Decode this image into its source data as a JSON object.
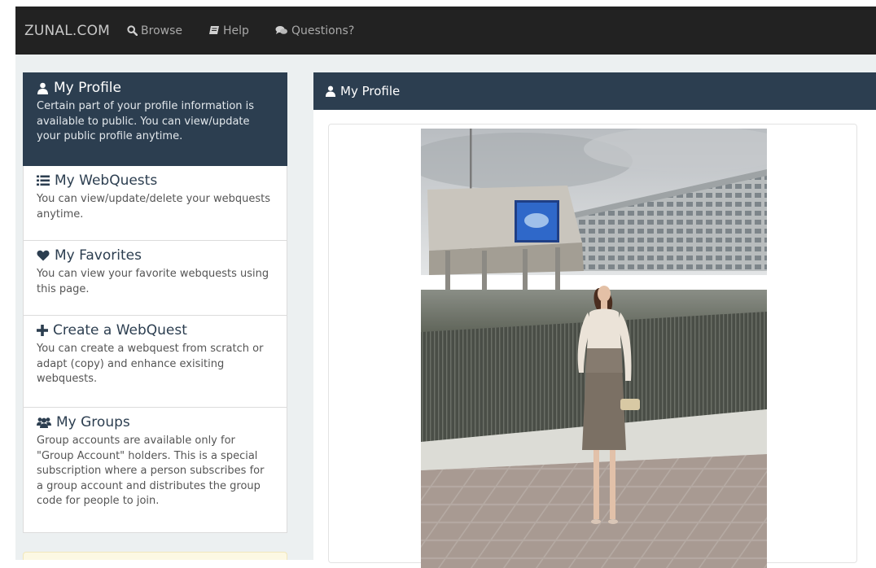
{
  "navbar": {
    "brand": "ZUNAL.COM",
    "links": [
      {
        "label": "Browse",
        "icon": "search-icon"
      },
      {
        "label": "Help",
        "icon": "book-icon"
      },
      {
        "label": "Questions?",
        "icon": "comments-icon"
      }
    ]
  },
  "sidebar": {
    "items": [
      {
        "title": "My Profile",
        "icon": "user-icon",
        "active": true,
        "desc": "Certain part of your profile information is available to public. You can view/update your public profile anytime."
      },
      {
        "title": "My WebQuests",
        "icon": "list-icon",
        "active": false,
        "desc": "You can view/update/delete your webquests anytime."
      },
      {
        "title": "My Favorites",
        "icon": "heart-icon",
        "active": false,
        "desc": "You can view your favorite webquests using this page."
      },
      {
        "title": "Create a WebQuest",
        "icon": "plus-icon",
        "active": false,
        "desc": "You can create a webquest from scratch or adapt (copy) and enhance exisiting webquests."
      },
      {
        "title": "My Groups",
        "icon": "users-icon",
        "active": false,
        "desc": "Group accounts are available only for \"Group Account\" holders. This is a special subscription where a person subscribes for a group account and distributes the group code for people to join."
      }
    ]
  },
  "main": {
    "panel_title": "My Profile"
  },
  "colors": {
    "navbar": "#222222",
    "primary": "#2c3e50",
    "page_bg": "#ecf0f1"
  }
}
